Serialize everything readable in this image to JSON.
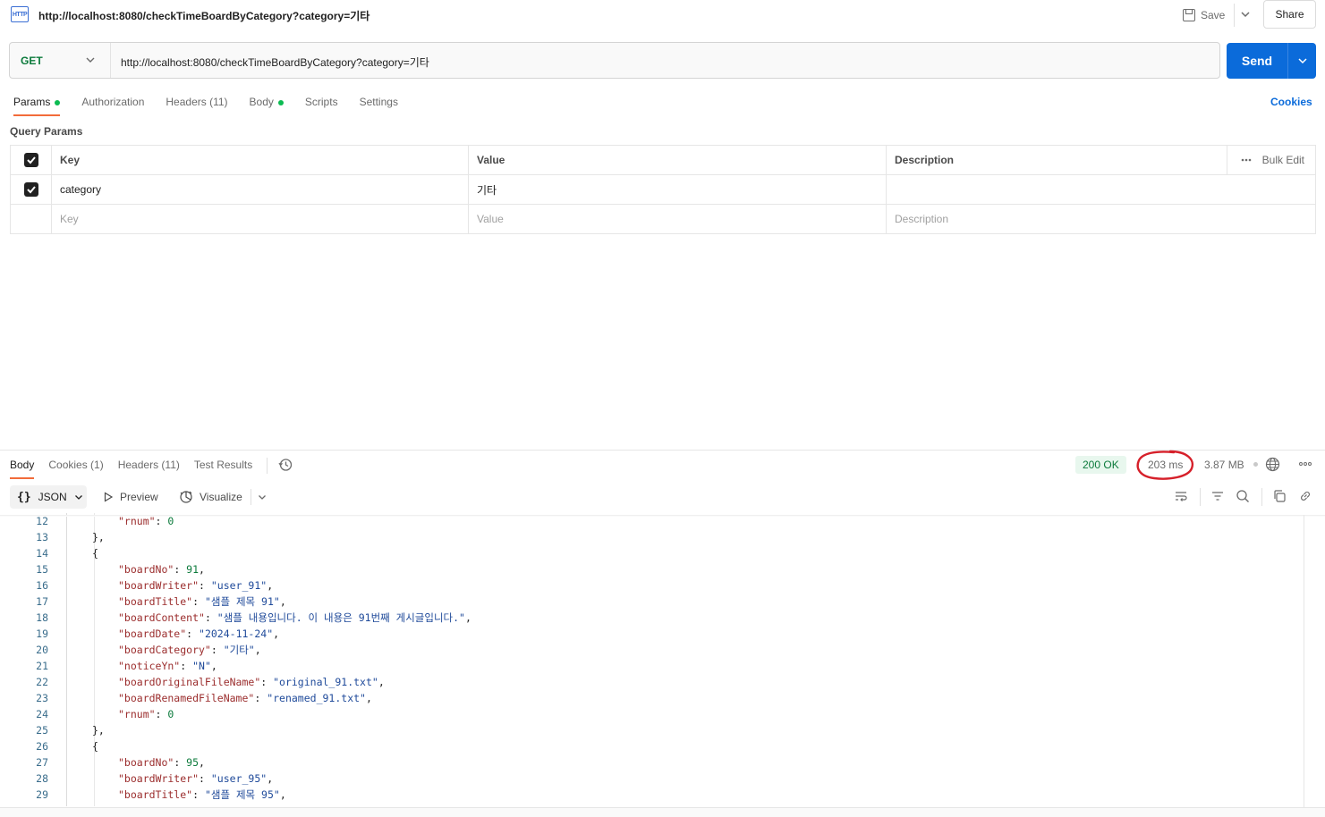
{
  "request": {
    "tab_title": "http://localhost:8080/checkTimeBoardByCategory?category=기타",
    "icon_text": "HTTP",
    "save_label": "Save",
    "share_label": "Share",
    "method": "GET",
    "url": "http://localhost:8080/checkTimeBoardByCategory?category=기타",
    "send_label": "Send"
  },
  "req_tabs": [
    {
      "label": "Params",
      "active": true,
      "dot": true
    },
    {
      "label": "Authorization"
    },
    {
      "label": "Headers (11)"
    },
    {
      "label": "Body",
      "dot": true
    },
    {
      "label": "Scripts"
    },
    {
      "label": "Settings"
    }
  ],
  "cookies_label": "Cookies",
  "query_params": {
    "title": "Query Params",
    "headers": {
      "key": "Key",
      "value": "Value",
      "description": "Description",
      "bulk_edit": "Bulk Edit"
    },
    "rows": [
      {
        "key": "category",
        "value": "기타",
        "description": ""
      }
    ],
    "placeholder": {
      "key": "Key",
      "value": "Value",
      "description": "Description"
    }
  },
  "response": {
    "tabs": [
      {
        "label": "Body",
        "active": true
      },
      {
        "label": "Cookies (1)"
      },
      {
        "label": "Headers (11)"
      },
      {
        "label": "Test Results"
      }
    ],
    "status": "200 OK",
    "time": "203 ms",
    "size": "3.87 MB",
    "format": "JSON",
    "preview_label": "Preview",
    "visualize_label": "Visualize",
    "annotation_color": "#d6202a"
  },
  "code_lines": [
    {
      "n": "12",
      "indent": 2,
      "parts": [
        [
          "k",
          "\"rnum\""
        ],
        [
          "p",
          ": "
        ],
        [
          "n",
          "0"
        ]
      ]
    },
    {
      "n": "13",
      "indent": 1,
      "parts": [
        [
          "p",
          "},"
        ]
      ]
    },
    {
      "n": "14",
      "indent": 1,
      "parts": [
        [
          "p",
          "{"
        ]
      ]
    },
    {
      "n": "15",
      "indent": 2,
      "parts": [
        [
          "k",
          "\"boardNo\""
        ],
        [
          "p",
          ": "
        ],
        [
          "n",
          "91"
        ],
        [
          "p",
          ","
        ]
      ]
    },
    {
      "n": "16",
      "indent": 2,
      "parts": [
        [
          "k",
          "\"boardWriter\""
        ],
        [
          "p",
          ": "
        ],
        [
          "s",
          "\"user_91\""
        ],
        [
          "p",
          ","
        ]
      ]
    },
    {
      "n": "17",
      "indent": 2,
      "parts": [
        [
          "k",
          "\"boardTitle\""
        ],
        [
          "p",
          ": "
        ],
        [
          "s",
          "\"샘플 제목 91\""
        ],
        [
          "p",
          ","
        ]
      ]
    },
    {
      "n": "18",
      "indent": 2,
      "parts": [
        [
          "k",
          "\"boardContent\""
        ],
        [
          "p",
          ": "
        ],
        [
          "s",
          "\"샘플 내용입니다. 이 내용은 91번째 게시글입니다.\""
        ],
        [
          "p",
          ","
        ]
      ]
    },
    {
      "n": "19",
      "indent": 2,
      "parts": [
        [
          "k",
          "\"boardDate\""
        ],
        [
          "p",
          ": "
        ],
        [
          "s",
          "\"2024-11-24\""
        ],
        [
          "p",
          ","
        ]
      ]
    },
    {
      "n": "20",
      "indent": 2,
      "parts": [
        [
          "k",
          "\"boardCategory\""
        ],
        [
          "p",
          ": "
        ],
        [
          "s",
          "\"기타\""
        ],
        [
          "p",
          ","
        ]
      ]
    },
    {
      "n": "21",
      "indent": 2,
      "parts": [
        [
          "k",
          "\"noticeYn\""
        ],
        [
          "p",
          ": "
        ],
        [
          "s",
          "\"N\""
        ],
        [
          "p",
          ","
        ]
      ]
    },
    {
      "n": "22",
      "indent": 2,
      "parts": [
        [
          "k",
          "\"boardOriginalFileName\""
        ],
        [
          "p",
          ": "
        ],
        [
          "s",
          "\"original_91.txt\""
        ],
        [
          "p",
          ","
        ]
      ]
    },
    {
      "n": "23",
      "indent": 2,
      "parts": [
        [
          "k",
          "\"boardRenamedFileName\""
        ],
        [
          "p",
          ": "
        ],
        [
          "s",
          "\"renamed_91.txt\""
        ],
        [
          "p",
          ","
        ]
      ]
    },
    {
      "n": "24",
      "indent": 2,
      "parts": [
        [
          "k",
          "\"rnum\""
        ],
        [
          "p",
          ": "
        ],
        [
          "n",
          "0"
        ]
      ]
    },
    {
      "n": "25",
      "indent": 1,
      "parts": [
        [
          "p",
          "},"
        ]
      ]
    },
    {
      "n": "26",
      "indent": 1,
      "parts": [
        [
          "p",
          "{"
        ]
      ]
    },
    {
      "n": "27",
      "indent": 2,
      "parts": [
        [
          "k",
          "\"boardNo\""
        ],
        [
          "p",
          ": "
        ],
        [
          "n",
          "95"
        ],
        [
          "p",
          ","
        ]
      ]
    },
    {
      "n": "28",
      "indent": 2,
      "parts": [
        [
          "k",
          "\"boardWriter\""
        ],
        [
          "p",
          ": "
        ],
        [
          "s",
          "\"user_95\""
        ],
        [
          "p",
          ","
        ]
      ]
    },
    {
      "n": "29",
      "indent": 2,
      "parts": [
        [
          "k",
          "\"boardTitle\""
        ],
        [
          "p",
          ": "
        ],
        [
          "s",
          "\"샘플 제목 95\""
        ],
        [
          "p",
          ","
        ]
      ]
    }
  ]
}
